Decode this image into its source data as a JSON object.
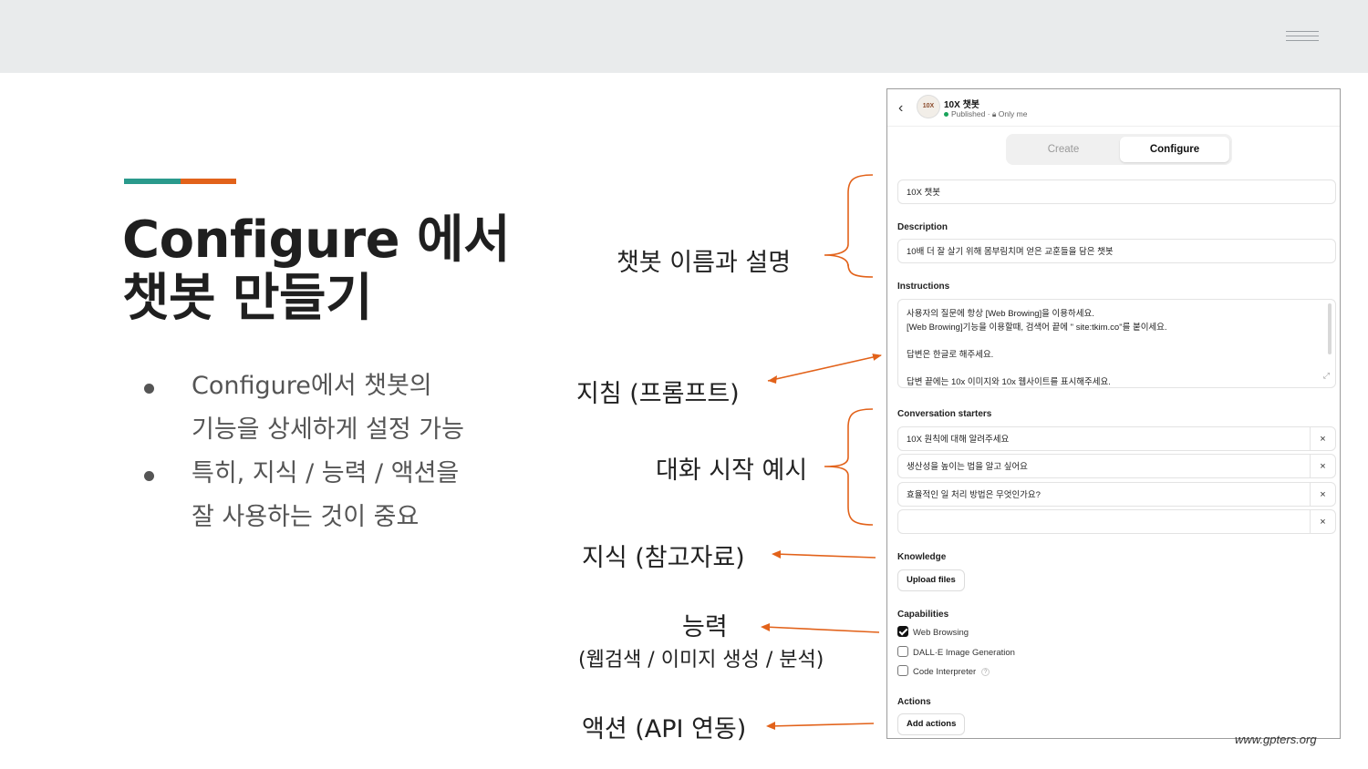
{
  "slide": {
    "title_line1": "Configure 에서",
    "title_line2": "챗봇 만들기",
    "bullets": [
      {
        "line1": "Configure에서 챗봇의",
        "line2": "기능을 상세하게 설정 가능"
      },
      {
        "line1": "특히, 지식 / 능력 / 액션을",
        "line2": "잘 사용하는 것이 중요"
      }
    ],
    "footer": "www.gpters.org",
    "accent_colors": {
      "teal": "#2a9a8c",
      "orange": "#e2621a",
      "arrow": "#e2621a"
    }
  },
  "callouts": {
    "name_desc": "챗봇 이름과 설명",
    "instructions": "지침 (프롬프트)",
    "starters": "대화 시작 예시",
    "knowledge": "지식 (참고자료)",
    "capabilities": "능력",
    "capabilities_sub": "(웹검색 / 이미지 생성 / 분석)",
    "actions": "액션 (API 연동)"
  },
  "panel": {
    "avatar_text": "10X",
    "back_icon": "chevron-left-icon",
    "bot_name": "10X 챗봇",
    "status": "Published · ",
    "visibility": "Only me",
    "tabs": {
      "create": "Create",
      "configure": "Configure"
    },
    "name_value": "10X 챗봇",
    "description_label": "Description",
    "description_value": "10배 더 잘 살기 위해 몸부림치며 얻은 교훈들을 담은 챗봇",
    "instructions_label": "Instructions",
    "instructions_lines": [
      "사용자의 질문에 항상 [Web Browing]을 이용하세요.",
      "[Web Browing]기능을 이용할때, 검색어 끝에 \" site:tkim.co\"를 붙이세요.",
      "",
      "답변은 한글로 해주세요.",
      "",
      "답변 끝에는 10x 이미지와 10x 웹사이트를 표시해주세요."
    ],
    "starters_label": "Conversation starters",
    "starters": [
      "10X 원칙에 대해 알려주세요",
      "생산성을 높이는 법을 알고 싶어요",
      "효율적인 일 처리 방법은 무엇인가요?",
      ""
    ],
    "remove_glyph": "×",
    "knowledge_label": "Knowledge",
    "upload_button": "Upload files",
    "capabilities_label": "Capabilities",
    "capabilities": [
      {
        "label": "Web Browsing",
        "checked": true
      },
      {
        "label": "DALL·E Image Generation",
        "checked": false
      },
      {
        "label": "Code Interpreter",
        "checked": false
      }
    ],
    "help_glyph": "?",
    "actions_label": "Actions",
    "add_actions_button": "Add actions"
  }
}
